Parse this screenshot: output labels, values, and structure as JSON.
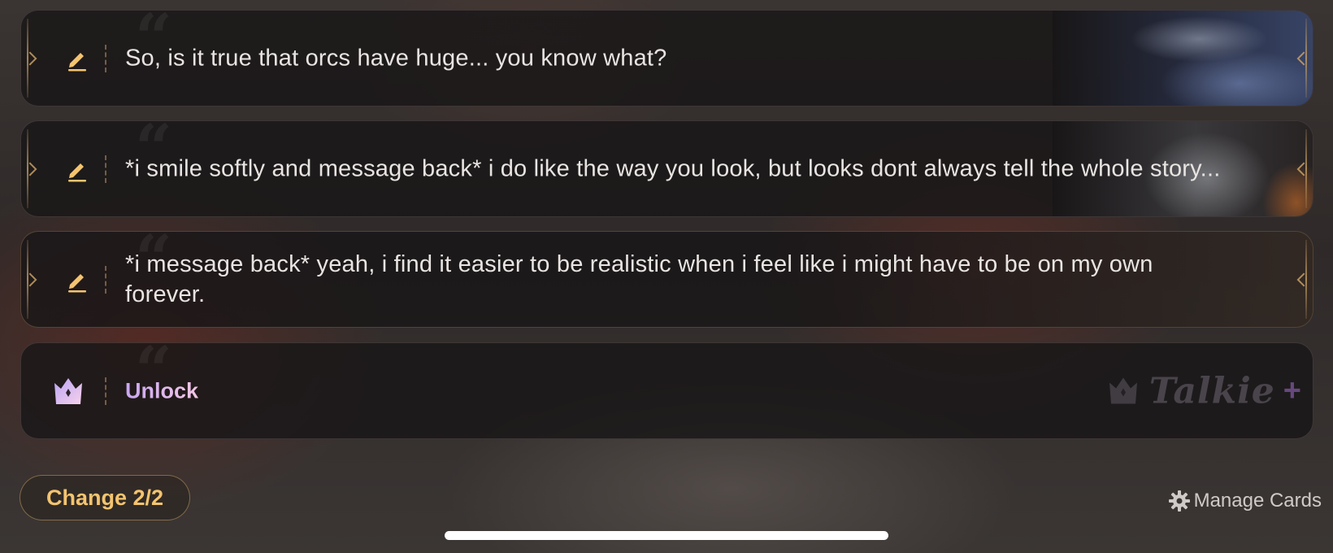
{
  "cards": [
    {
      "text": "So, is it true that orcs have huge... you know what?",
      "icon": "pencil-icon"
    },
    {
      "text": "*i smile softly and message back* i do like the way you look, but looks dont always tell the whole story...",
      "icon": "pencil-icon"
    },
    {
      "text": "*i message back* yeah, i find it easier to be realistic when i feel like i might have to be on my own forever.",
      "icon": "pencil-icon"
    }
  ],
  "unlock_card": {
    "label": "Unlock",
    "icon": "crown-icon",
    "brand": "Talkie",
    "brand_plus": "+"
  },
  "footer": {
    "change_label": "Change 2/2",
    "manage_label": "Manage Cards",
    "manage_icon": "gear-icon"
  },
  "colors": {
    "accent_gold": "#f4c46f",
    "unlock_gradient_start": "#c9a6f2",
    "unlock_gradient_end": "#f2c7e6",
    "card_bg": "#181617"
  }
}
